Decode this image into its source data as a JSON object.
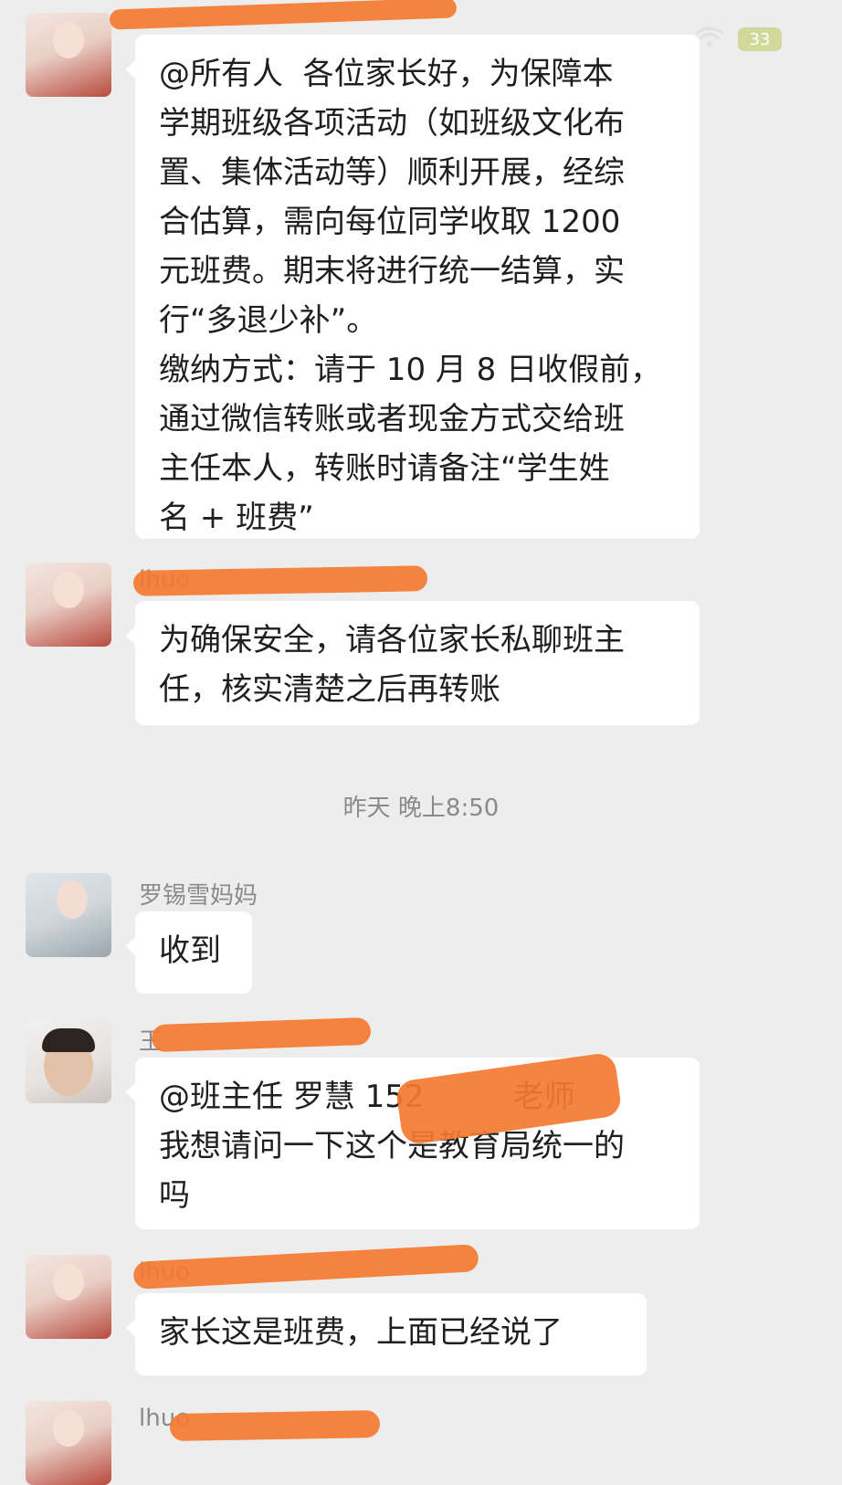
{
  "status_bar": {
    "battery": "33"
  },
  "timestamp": "昨天 晚上8:50",
  "messages": [
    {
      "name": "",
      "text": "@所有人  各位家长好，为保障本\n学期班级各项活动（如班级文化布\n置、集体活动等）顺利开展，经综\n合估算，需向每位同学收取 1200\n元班费。期末将进行统一结算，实\n行“多退少补”。\n缴纳方式：请于 10 月 8 日收假前，\n通过微信转账或者现金方式交给班\n主任本人，转账时请备注“学生姓\n名 + 班费”"
    },
    {
      "name": "lhuo",
      "text": "为确保安全，请各位家长私聊班主\n任，核实清楚之后再转账"
    },
    {
      "name": "罗锡雪妈妈",
      "text": "收到"
    },
    {
      "name": "王",
      "text": "@班主任 罗慧 152         老师\n我想请问一下这个是教育局统一的\n吗"
    },
    {
      "name": "lhuo",
      "text": "家长这是班费，上面已经说了"
    },
    {
      "name": "lhuo"
    }
  ],
  "colors": {
    "background": "#ededed",
    "bubble": "#ffffff",
    "redaction": "#f47a30"
  }
}
